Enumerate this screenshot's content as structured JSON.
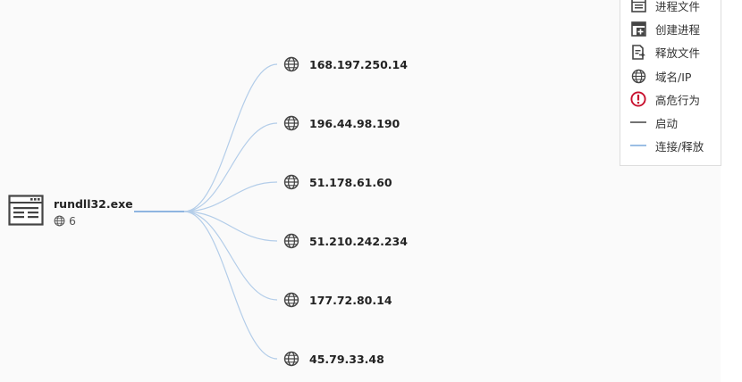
{
  "process": {
    "name": "rundll32.exe",
    "network_count": "6"
  },
  "ip_nodes": [
    {
      "label": "168.197.250.14"
    },
    {
      "label": "196.44.98.190"
    },
    {
      "label": "51.178.61.60"
    },
    {
      "label": "51.210.242.234"
    },
    {
      "label": "177.72.80.14"
    },
    {
      "label": "45.79.33.48"
    }
  ],
  "legend": {
    "items": [
      {
        "label": "进程文件",
        "icon": "process-file-icon"
      },
      {
        "label": "创建进程",
        "icon": "create-process-icon"
      },
      {
        "label": "释放文件",
        "icon": "release-file-icon"
      },
      {
        "label": "域名/IP",
        "icon": "globe-icon"
      },
      {
        "label": "高危行为",
        "icon": "alert-icon"
      },
      {
        "label": "启动",
        "icon": "start-line-icon"
      },
      {
        "label": "连接/释放",
        "icon": "connect-line-icon"
      }
    ]
  },
  "colors": {
    "edge_main": "#6a9ed8",
    "edge_branch": "#b3cde9",
    "alert": "#c8102e",
    "icon": "#444444"
  }
}
